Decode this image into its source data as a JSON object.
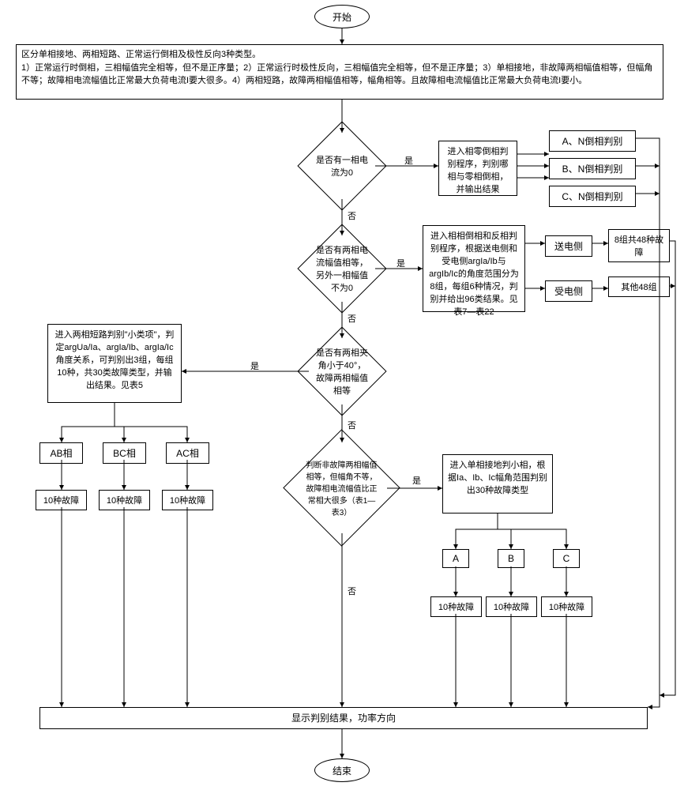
{
  "terminals": {
    "start": "开始",
    "end": "结束"
  },
  "intro": "区分单相接地、两相短路、正常运行倒相及极性反向3种类型。\n1）正常运行时倒相，三相幅值完全相等，但不是正序量；2）正常运行时极性反向，三相幅值完全相等，但不是正序量；3）单相接地，非故障两相幅值相等，但幅角不等；故障相电流幅值比正常最大负荷电流I要大很多。4）两相短路，故障两相幅值相等，幅角相等。且故障相电流幅值比正常最大负荷电流I要小。",
  "decisions": {
    "d1": "是否有一相电流为0",
    "d2": "是否有两相电流幅值相等，另外一相幅值不为0",
    "d3": "是否有两相夹角小于40°，故障两相幅值相等",
    "d4": "判断非故障两相幅值相等，但幅角不等，故障相电流幅值比正常相大很多（表1—表3）"
  },
  "procs": {
    "p1": "进入相零倒相判别程序，判别哪相与零相倒相，并输出结果",
    "p2": "进入相相倒相和反相判别程序，根据送电侧和受电侧argIa/Ib与argIb/Ic的角度范围分为8组，每组6种情况，判别并给出96类结果。见表7—表22",
    "p3": "进入两相短路判别\"小类项\"，判定argUa/Ia、argIa/Ib、argIa/Ic角度关系，可判别出3组，每组10种，共30类故障类型，并输出结果。见表5",
    "p4": "进入单相接地判小相，根据Ia、Ib、Ic幅角范围判别出30种故障类型",
    "result": "显示判别结果，功率方向"
  },
  "outs": {
    "an": "A、N倒相判别",
    "bn": "B、N倒相判别",
    "cn": "C、N倒相判别",
    "send": "送电侧",
    "recv": "受电侧",
    "g8": "8组共48种故障",
    "g48": "其他48组",
    "ab": "AB相",
    "bc": "BC相",
    "ac": "AC相",
    "f10": "10种故障",
    "a": "A",
    "b": "B",
    "c": "C"
  },
  "labels": {
    "yes": "是",
    "no": "否"
  }
}
